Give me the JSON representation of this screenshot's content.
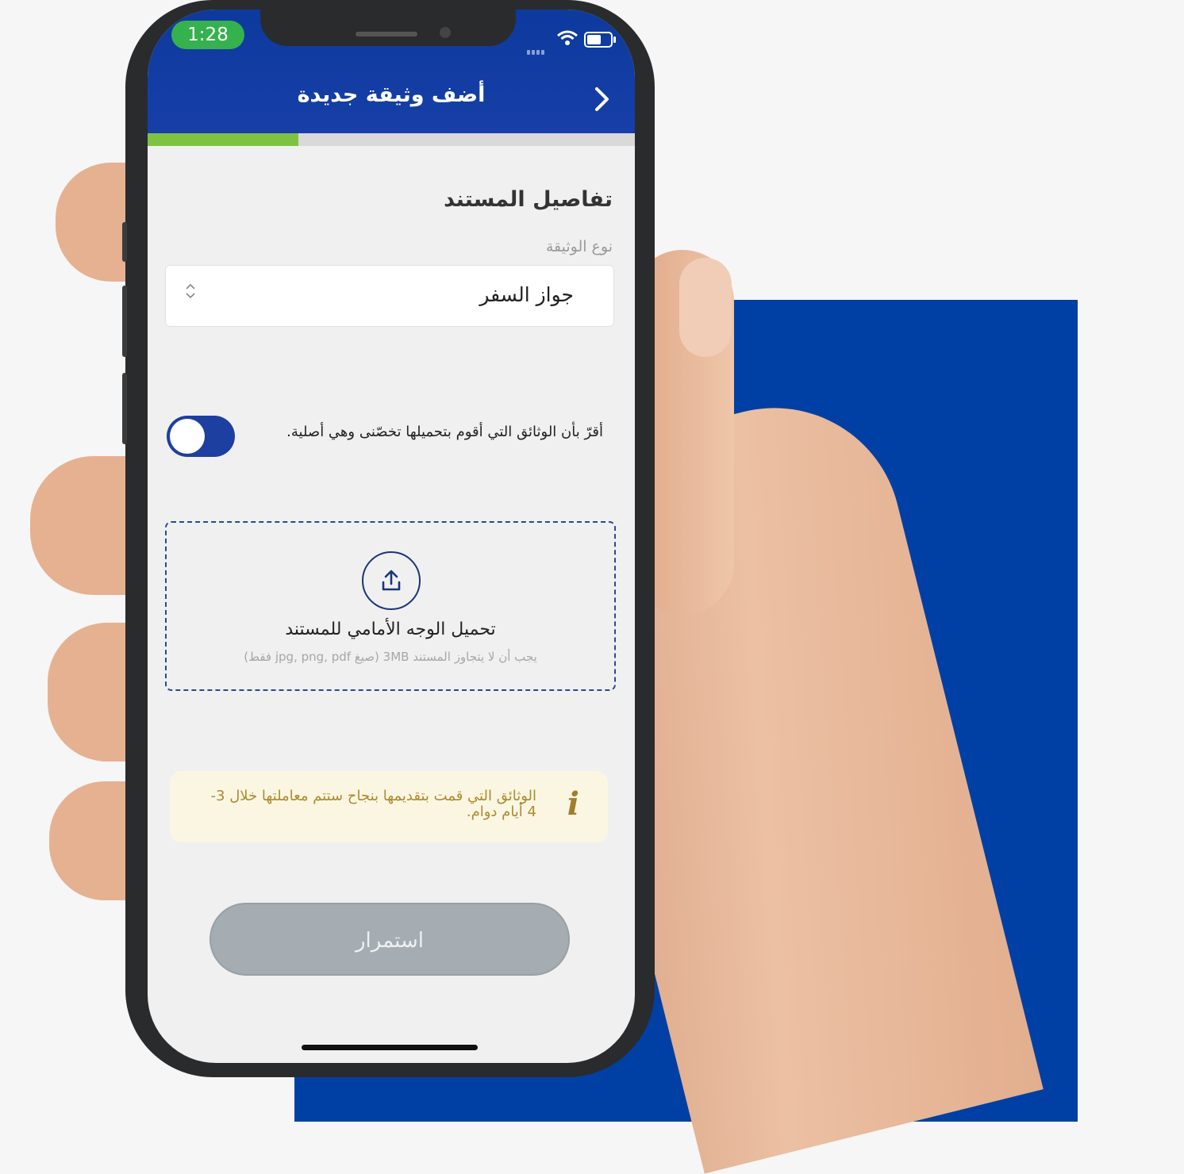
{
  "status_bar": {
    "time": "1:28",
    "battery_level": 0.6
  },
  "header": {
    "title": "أضف وثيقة جديدة",
    "back_icon": "chevron-right-icon"
  },
  "progress": {
    "value": 0.31,
    "fill_color": "#7fc242"
  },
  "document_details": {
    "section_title": "تفاصيل المستند",
    "type_label": "نوع الوثيقة",
    "type_value": "جواز السفر"
  },
  "consent": {
    "text": "أقرّ بأن الوثائق التي أقوم بتحميلها تخصّنى وهي أصلية.",
    "toggle_on": false
  },
  "upload": {
    "title": "تحميل الوجه الأمامي للمستند",
    "hint": "يجب أن لا يتجاوز المستند 3MB (صيغ jpg, png, pdf فقط)"
  },
  "notice": {
    "text": "الوثائق التي قمت بتقديمها بنجاح ستتم معاملتها خلال 3-4 أيام دوام."
  },
  "continue_label": "استمرار",
  "colors": {
    "brand_blue": "#0040a4",
    "notice_text": "#ad8b2e"
  }
}
